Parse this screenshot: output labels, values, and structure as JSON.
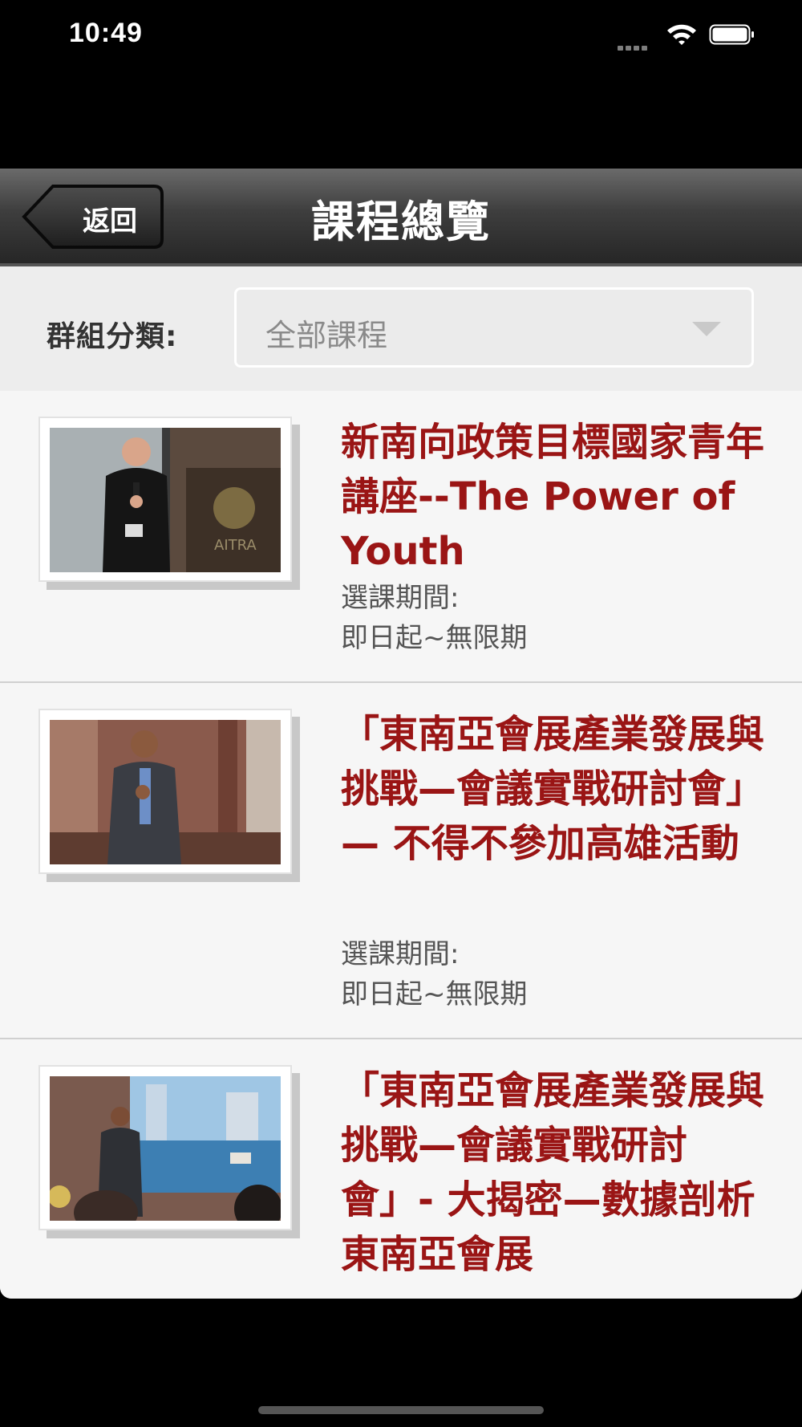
{
  "status_bar": {
    "time": "10:49"
  },
  "nav": {
    "back_label": "返回",
    "title": "課程總覽"
  },
  "filter": {
    "label": "群組分類:",
    "selected_value": "全部課程"
  },
  "courses": [
    {
      "title": "新南向政策目標國家青年講座--The Power of Youth",
      "period_label": "選課期間:",
      "period_value": "即日起~無限期"
    },
    {
      "title": "「東南亞會展產業發展與挑戰—會議實戰研討會」— 不得不參加高雄活動",
      "period_label": "選課期間:",
      "period_value": "即日起~無限期"
    },
    {
      "title": "「東南亞會展產業發展與挑戰—會議實戰研討會」- 大揭密—數據剖析東南亞會展",
      "period_label": "",
      "period_value": ""
    }
  ],
  "colors": {
    "title_red": "#9a1515",
    "nav_dark": "#2a2a2a"
  }
}
